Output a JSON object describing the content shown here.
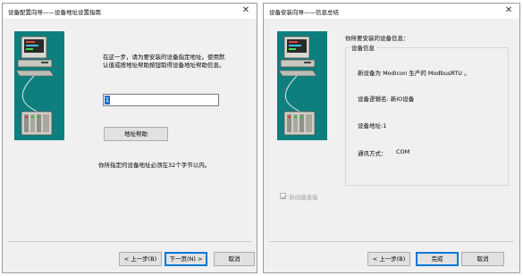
{
  "left_dialog": {
    "title": "设备配置向导——设备地址设置指南",
    "close": "✕",
    "instruction_line1": "在这一步，请为要安装的设备指定地址。使用默",
    "instruction_line2": "认值或按地址帮助按钮取得设备地址帮助信息。",
    "address_value": "1",
    "help_button": "地址帮助",
    "hint": "你所指定的设备地址必须在32个字节以内。",
    "buttons": {
      "back": "< 上一步(B)",
      "next": "下一页(N) >",
      "cancel": "取消"
    }
  },
  "right_dialog": {
    "title": "设备安装向导——信息总结",
    "close": "✕",
    "heading": "你所要安装的设备信息：",
    "group_label": "设备信息",
    "new_device": "新设备为 Modicon 生产的 ModbusRTU 。",
    "logical_name": "设备逻辑名: 新IO设备",
    "address": "设备地址:1",
    "comm_label": "通讯方式：",
    "comm_value": "COM",
    "auto_restore": "自动建连接",
    "auto_restore_checked": true,
    "buttons": {
      "back": "< 上一步(B)",
      "finish": "完成",
      "cancel": "取消"
    }
  }
}
